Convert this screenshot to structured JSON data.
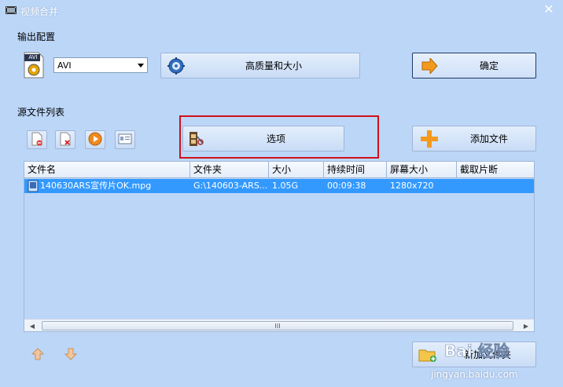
{
  "window": {
    "title": "视频合并"
  },
  "output_config": {
    "label": "输出配置",
    "format_badge": "AVI",
    "format_value": "AVI",
    "quality_button_label": "高质量和大小",
    "confirm_button_label": "确定"
  },
  "source_list": {
    "label": "源文件列表",
    "options_button_label": "选项",
    "add_file_button_label": "添加文件",
    "new_folder_button_label": "新加文件夹"
  },
  "table": {
    "columns": [
      "文件名",
      "文件夹",
      "大小",
      "持续时间",
      "屏幕大小",
      "截取片断"
    ],
    "rows": [
      {
        "name": "140630ARS宣传片OK.mpg",
        "folder": "G:\\140603-ARS...",
        "size": "1.05G",
        "duration": "00:09:38",
        "resolution": "1280x720",
        "clip": ""
      }
    ]
  },
  "watermark": {
    "logo_text": "Bai 经验",
    "url": "jingyan.baidu.com"
  },
  "colors": {
    "background": "#bcd6f8",
    "selection": "#3399ff",
    "highlight_box": "#d0101a"
  }
}
